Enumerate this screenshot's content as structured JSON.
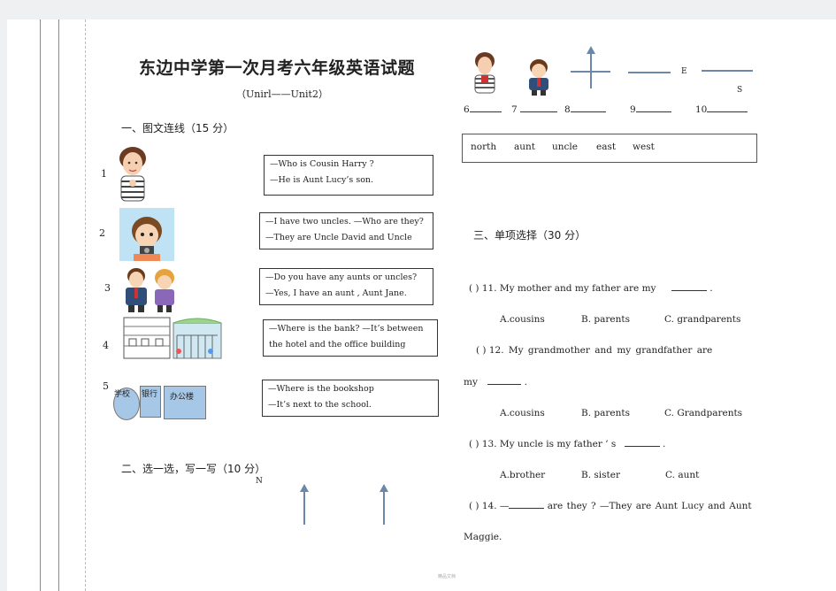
{
  "title": "东边中学第一次月考六年级英语试题",
  "subtitle": "（Unirl——Unit2）",
  "section1": {
    "heading": "一、图文连线（15 分）",
    "items": [
      {
        "num": "1",
        "lines": [
          "—Who is Cousin Harry ?",
          "—He is Aunt Lucy’s son."
        ]
      },
      {
        "num": "2",
        "lines": [
          "—I have two uncles. —Who are they?",
          "—They are Uncle David and Uncle"
        ]
      },
      {
        "num": "3",
        "lines": [
          "—Do you have any aunts or uncles?",
          "—Yes, I have an aunt , Aunt Jane."
        ]
      },
      {
        "num": "4",
        "lines": [
          "—Where is the bank? —It’s between",
          "the hotel and the office building"
        ]
      },
      {
        "num": "5",
        "lines": [
          "—Where is the bookshop",
          "—It’s next to the school."
        ]
      }
    ],
    "place_labels": {
      "school": "学校",
      "bank": "银行",
      "office": "办公楼"
    }
  },
  "section2": {
    "heading": "二、选一选，写一写（10 分）",
    "n_label": "N"
  },
  "compass": {
    "e_label": "E",
    "s_label": "S"
  },
  "blanks": [
    "6",
    "7",
    "8",
    "9",
    "10"
  ],
  "wordbank": [
    "north",
    "aunt",
    "uncle",
    "east",
    "west"
  ],
  "section3": {
    "heading": "三、单项选择（30 分）",
    "q11": {
      "paren": "(    )",
      "text": "11. My mother and my father are my",
      "end": ".",
      "options": [
        "A.cousins",
        "B. parents",
        "C. grandparents"
      ]
    },
    "q12": {
      "paren": "(      )",
      "text": "12.   My   grandmother   and   my   grandfather   are",
      "cont": "my",
      "end": ".",
      "options": [
        "A.cousins",
        "B. parents",
        "C. Grandparents"
      ]
    },
    "q13": {
      "paren": "(    )",
      "text": "13. My uncle is my father ’ s",
      "end": ".",
      "options": [
        "A.brother",
        "B. sister",
        "C. aunt"
      ]
    },
    "q14": {
      "paren": "(    )",
      "text": "14. —",
      "rest": "are   they  ?  —They   are   Aunt   Lucy   and   Aunt",
      "cont": "Maggie."
    }
  },
  "footer": "精品文档"
}
